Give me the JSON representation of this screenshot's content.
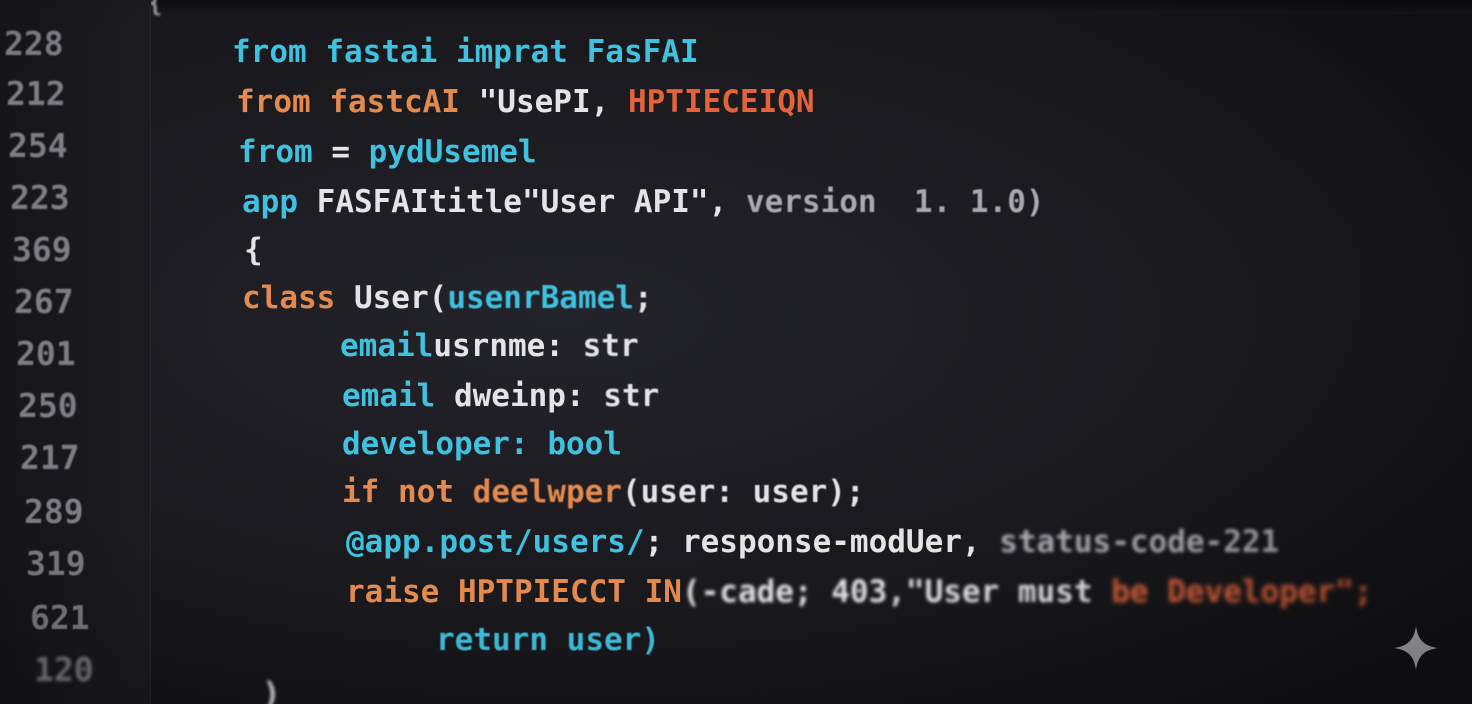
{
  "editor": {
    "top_fragment": "{ {",
    "line_numbers": [
      "228",
      "212",
      "254",
      "223",
      "369",
      "267",
      "201",
      "250",
      "217",
      "289",
      "319",
      "621",
      "120"
    ],
    "lines": [
      [
        {
          "t": "from ",
          "c": "kw-cyan"
        },
        {
          "t": "fastai ",
          "c": "kw-cyan"
        },
        {
          "t": "imprat ",
          "c": "kw-cyan"
        },
        {
          "t": "FasFAI",
          "c": "kw-cyan"
        }
      ],
      [
        {
          "t": "from ",
          "c": "kw-orange"
        },
        {
          "t": "fastcAI ",
          "c": "kw-orange"
        },
        {
          "t": "\"UsePI, ",
          "c": "id-white"
        },
        {
          "t": "HPTIECEIQN",
          "c": "str-red"
        }
      ],
      [
        {
          "t": "from ",
          "c": "kw-cyan"
        },
        {
          "t": "= ",
          "c": "id-white"
        },
        {
          "t": "pydUsemel",
          "c": "kw-cyan"
        }
      ],
      [
        {
          "t": "app ",
          "c": "kw-cyan"
        },
        {
          "t": "FASFAItitle\"User API\", ",
          "c": "id-white"
        },
        {
          "t": "version  ",
          "c": "dim"
        },
        {
          "t": "1. 1.0)",
          "c": "dim"
        }
      ],
      [
        {
          "t": "{",
          "c": "id-white"
        }
      ],
      [
        {
          "t": "class ",
          "c": "kw-orange"
        },
        {
          "t": "User(",
          "c": "id-white"
        },
        {
          "t": "usenrBamel",
          "c": "kw-cyan"
        },
        {
          "t": ";",
          "c": "id-white"
        }
      ],
      [
        {
          "t": "email",
          "c": "kw-cyan"
        },
        {
          "t": "usrnme: ",
          "c": "id-white"
        },
        {
          "t": "str",
          "c": "id-white"
        }
      ],
      [
        {
          "t": "email ",
          "c": "kw-cyan"
        },
        {
          "t": "dweinp: ",
          "c": "id-white"
        },
        {
          "t": "str",
          "c": "id-white"
        }
      ],
      [
        {
          "t": "developer: ",
          "c": "kw-cyan"
        },
        {
          "t": "bool",
          "c": "kw-cyan"
        }
      ],
      [
        {
          "t": "if ",
          "c": "kw-orange"
        },
        {
          "t": "not ",
          "c": "kw-orange"
        },
        {
          "t": "deelwper",
          "c": "kw-orange"
        },
        {
          "t": "(user: user);",
          "c": "id-white"
        }
      ],
      [
        {
          "t": "@app.post/users/",
          "c": "kw-cyan"
        },
        {
          "t": "; response-modUer, ",
          "c": "id-white"
        },
        {
          "t": "status-code-221",
          "c": "dim"
        }
      ],
      [
        {
          "t": "raise ",
          "c": "kw-orange"
        },
        {
          "t": "HPTPIECCT IN",
          "c": "kw-orange"
        },
        {
          "t": "(-cade; 403,\"User must ",
          "c": "id-white"
        },
        {
          "t": "be Developer\";",
          "c": "str-red"
        }
      ],
      [
        {
          "t": "return ",
          "c": "kw-cyan"
        },
        {
          "t": "user)",
          "c": "kw-cyan"
        }
      ]
    ],
    "bottom_fragment": ")"
  },
  "colors": {
    "background": "#1a1a1f",
    "keyword_orange": "#e58a4e",
    "keyword_cyan": "#3fc1df",
    "identifier": "#e4e4e6",
    "string_red": "#e2643a",
    "line_number": "#7e7e84"
  },
  "icons": {
    "corner_watermark": "sparkle-icon"
  }
}
